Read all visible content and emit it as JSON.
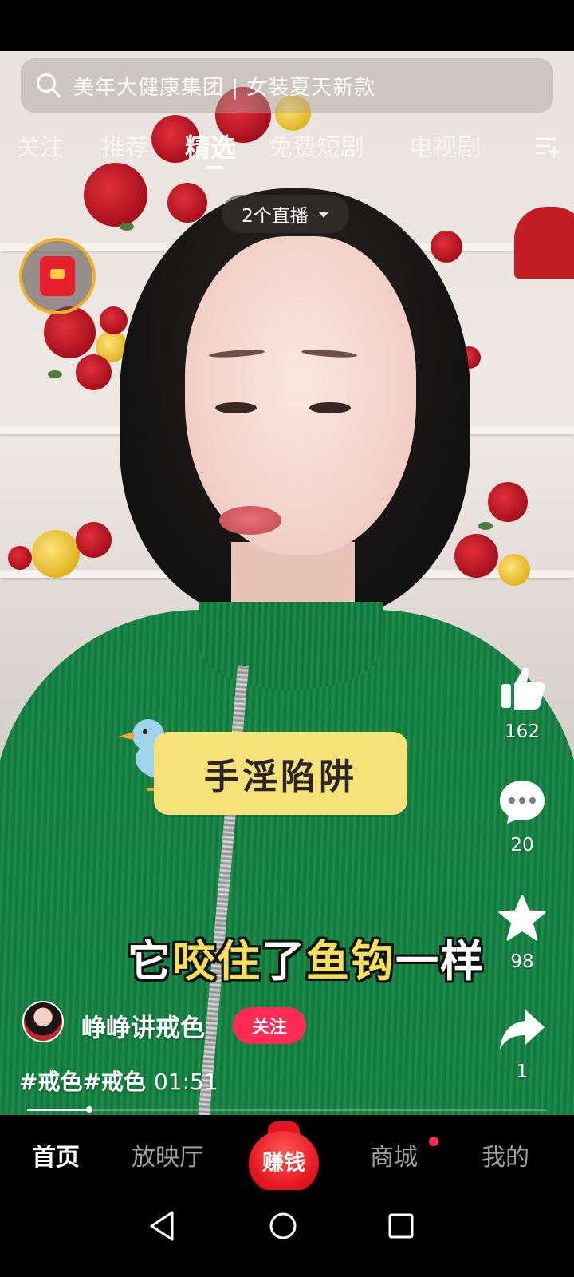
{
  "search": {
    "placeholder": "美年大健康集团 | 女装夏天新款"
  },
  "tabs": [
    {
      "label": "关注"
    },
    {
      "label": "推荐"
    },
    {
      "label": "精选",
      "active": true
    },
    {
      "label": "免费短剧"
    },
    {
      "label": "电视剧"
    }
  ],
  "live": {
    "label": "2个直播"
  },
  "video": {
    "sticker_text": "手淫陷阱",
    "subtitle": {
      "part1": "它",
      "part2": "咬住",
      "part3": "了",
      "part4": "鱼钩",
      "part5": "一样"
    }
  },
  "actions": {
    "likes": "162",
    "comments": "20",
    "favorites": "98",
    "shares": "1"
  },
  "author": {
    "name": "峥峥讲戒色",
    "follow_label": "关注"
  },
  "caption": {
    "tag1": "#戒色",
    "tag2": "#戒色",
    "time": "01:51"
  },
  "playback_progress": 0.12,
  "bottom_nav": [
    {
      "label": "首页",
      "active": true
    },
    {
      "label": "放映厅"
    },
    {
      "label": "赚钱"
    },
    {
      "label": "商城",
      "badge": true
    },
    {
      "label": "我的"
    }
  ],
  "colors": {
    "accent": "#fe2c55",
    "sticker": "#f7e27a",
    "subtitle_highlight": "#f6e05a",
    "shirt": "#1a8a47"
  },
  "icons": [
    "search-icon",
    "menu-add-icon",
    "red-packet-icon",
    "thumbs-up-icon",
    "comment-icon",
    "star-icon",
    "share-icon",
    "back-icon",
    "home-icon",
    "recents-icon"
  ]
}
